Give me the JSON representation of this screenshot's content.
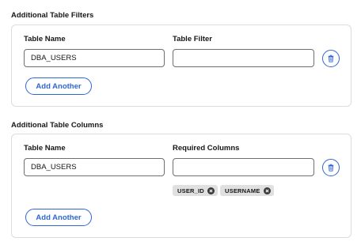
{
  "filters_section": {
    "title": "Additional Table Filters",
    "col_table_name": "Table Name",
    "col_table_filter": "Table Filter",
    "table_name_value": "DBA_USERS",
    "table_filter_value": "",
    "add_button": "Add Another"
  },
  "columns_section": {
    "title": "Additional Table Columns",
    "col_table_name": "Table Name",
    "col_required_columns": "Required Columns",
    "table_name_value": "DBA_USERS",
    "required_columns_value": "",
    "tags": [
      "USER_ID",
      "USERNAME"
    ],
    "add_button": "Add Another"
  },
  "colors": {
    "accent": "#2f66d4",
    "tag_bg": "#e0e0e0",
    "border": "#dcdcdc"
  },
  "icons": {
    "delete": "trash-icon",
    "remove_tag": "close-circle-icon"
  }
}
